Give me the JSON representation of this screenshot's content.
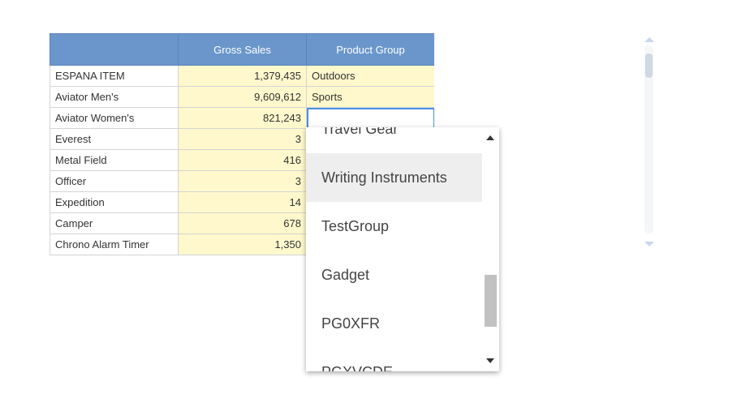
{
  "table": {
    "headers": [
      "",
      "Gross Sales",
      "Product Group"
    ],
    "rows": [
      {
        "name": "ESPANA ITEM",
        "gross": "1,379,435",
        "group": "Outdoors"
      },
      {
        "name": "Aviator Men's",
        "gross": "9,609,612",
        "group": "Sports"
      },
      {
        "name": "Aviator Women's",
        "gross": "821,243",
        "group": ""
      },
      {
        "name": "Everest",
        "gross": "3",
        "group": ""
      },
      {
        "name": "Metal Field",
        "gross": "416",
        "group": ""
      },
      {
        "name": "Officer",
        "gross": "3",
        "group": ""
      },
      {
        "name": "Expedition",
        "gross": "14",
        "group": ""
      },
      {
        "name": "Camper",
        "gross": "678",
        "group": ""
      },
      {
        "name": "Chrono Alarm Timer",
        "gross": "1,350",
        "group": ""
      }
    ]
  },
  "dropdown": {
    "options": [
      "Travel Gear",
      "Writing Instruments",
      "TestGroup",
      "Gadget",
      "PG0XFR",
      "PGXVCDE"
    ],
    "hovered": "Writing Instruments"
  },
  "colors": {
    "header_bg": "#6a96cb",
    "editable_bg": "#fff8cc",
    "focus_border": "#4a90e2",
    "accent_bar": "#f5d76e"
  },
  "icons": {
    "dropdown_scroll_up": "chevron-up-icon",
    "dropdown_scroll_down": "chevron-down-icon"
  }
}
